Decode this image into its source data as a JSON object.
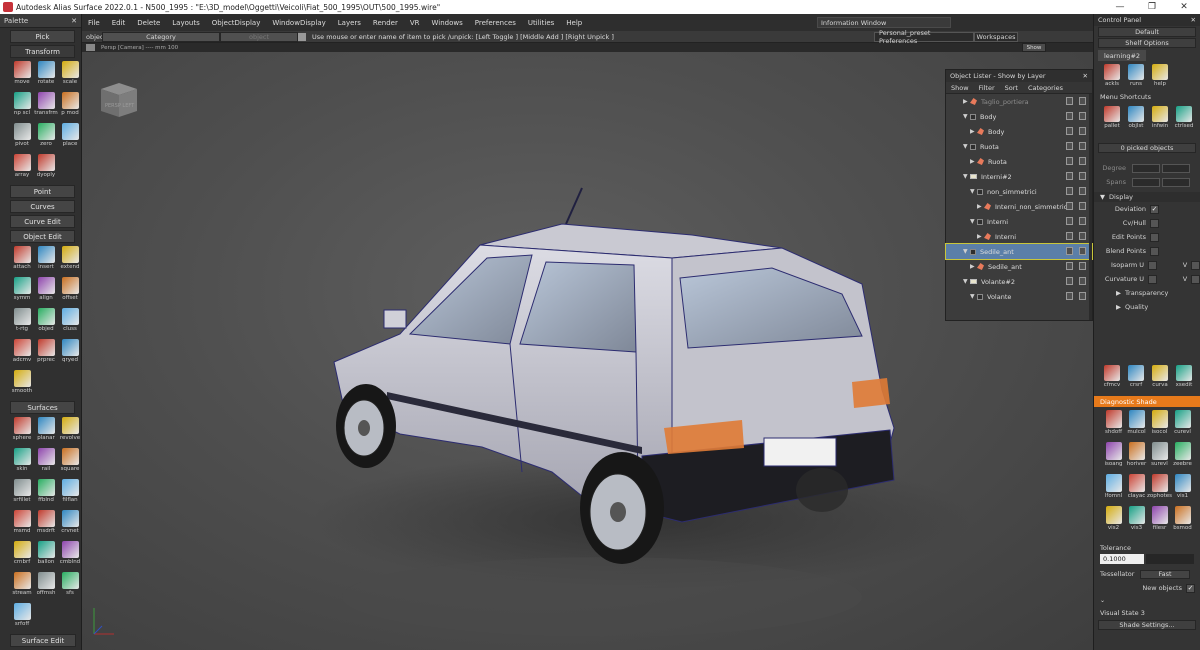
{
  "window": {
    "title": "Autodesk Alias Surface 2022.0.1   - N500_1995 : \"E:\\3D_model\\Oggetti\\Veicoli\\Fiat_500_1995\\OUT\\500_1995.wire\"",
    "min": "—",
    "max": "❐",
    "close": "✕"
  },
  "palette": {
    "title": "Palette",
    "close": "✕",
    "pick": "Pick",
    "transform": "Transform",
    "transform_tools": [
      "move",
      "rotate",
      "scale",
      "np scl",
      "transfrm",
      "p mod",
      "pivot",
      "zero",
      "place",
      "array",
      "dyoply"
    ],
    "point": "Point",
    "curves": "Curves",
    "curve_edit": "Curve Edit",
    "object_edit": "Object Edit",
    "object_edit_tools": [
      "attach",
      "insert",
      "extend",
      "symm",
      "align",
      "offset",
      "t-rtg",
      "objed",
      "cluss",
      "adcmv",
      "prprec",
      "qryed",
      "smooth"
    ],
    "surfaces": "Surfaces",
    "surface_tools": [
      "sphere",
      "planar",
      "revolve",
      "skin",
      "rail",
      "square",
      "srfillet",
      "ffblnd",
      "filflan",
      "msmd",
      "msdrft",
      "crvnet",
      "crnbrf",
      "ballon",
      "cmblnd",
      "stream",
      "offmsh",
      "sfs",
      "srfoff"
    ],
    "surface_edit": "Surface Edit"
  },
  "menubar": {
    "items": [
      "File",
      "Edit",
      "Delete",
      "Layouts",
      "ObjectDisplay",
      "WindowDisplay",
      "Layers",
      "Render",
      "VR",
      "Windows",
      "Preferences",
      "Utilities",
      "Help"
    ],
    "info_window": "Information Window"
  },
  "toolbar": {
    "object": "object",
    "category": "Category",
    "object_field": "object",
    "message": "Use mouse or enter name of item to pick /unpick: [Left Toggle ] [Middle Add ] [Right Unpick ]",
    "preset": "Personal_preset Preferences",
    "workspaces": "Workspaces",
    "show": "Show",
    "persp": "Persp [Camera] ---- mm 100"
  },
  "viewport": {
    "viewcube_label": "PERSP LEFT"
  },
  "lister": {
    "title": "Object Lister - Show by Layer",
    "close": "✕",
    "menu": [
      "Show",
      "Filter",
      "Sort",
      "Categories"
    ],
    "rows": [
      {
        "label": "Taglio_portiera",
        "indent": 1,
        "kind": "mesh",
        "tri": "▶",
        "dim": true
      },
      {
        "label": "Body",
        "indent": 1,
        "kind": "box",
        "tri": "▼"
      },
      {
        "label": "Body",
        "indent": 2,
        "kind": "mesh",
        "tri": "▶"
      },
      {
        "label": "Ruota",
        "indent": 1,
        "kind": "box",
        "tri": "▼"
      },
      {
        "label": "Ruota",
        "indent": 2,
        "kind": "mesh",
        "tri": "▶"
      },
      {
        "label": "Interni#2",
        "indent": 1,
        "kind": "fold",
        "tri": "▼"
      },
      {
        "label": "non_simmetrici",
        "indent": 2,
        "kind": "box",
        "tri": "▼"
      },
      {
        "label": "Interni_non_simmetrici",
        "indent": 3,
        "kind": "mesh",
        "tri": "▶"
      },
      {
        "label": "Interni",
        "indent": 2,
        "kind": "box",
        "tri": "▼"
      },
      {
        "label": "Interni",
        "indent": 3,
        "kind": "mesh",
        "tri": "▶"
      },
      {
        "label": "Sedile_ant",
        "indent": 1,
        "kind": "box",
        "tri": "▼",
        "selected": true
      },
      {
        "label": "Sedile_ant",
        "indent": 2,
        "kind": "mesh",
        "tri": "▶"
      },
      {
        "label": "Volante#2",
        "indent": 1,
        "kind": "fold",
        "tri": "▼"
      },
      {
        "label": "Volante",
        "indent": 2,
        "kind": "box",
        "tri": "▼"
      }
    ]
  },
  "control_panel": {
    "title": "Control Panel",
    "close": "✕",
    "default": "Default",
    "shelf_options": "Shelf Options",
    "learning_tab": "learning#2",
    "learning_tools": [
      "ackls",
      "runs",
      "help"
    ],
    "menu_shortcuts": "Menu Shortcuts",
    "shortcut_tools": [
      "pallet",
      "objlst",
      "infwin",
      "ctrlsed"
    ],
    "picked_objects": "0 picked objects",
    "degree": "Degree",
    "spans": "Spans",
    "display": "Display",
    "display_rows": [
      {
        "label": "Deviation",
        "checked": true
      },
      {
        "label": "Cv/Hull",
        "checked": false
      },
      {
        "label": "Edit Points",
        "checked": false
      },
      {
        "label": "Blend Points",
        "checked": false
      },
      {
        "label": "Isoparm U",
        "checked": false,
        "extra": "V"
      },
      {
        "label": "Curvature U",
        "checked": false,
        "extra": "V"
      }
    ],
    "transparency": "Transparency",
    "quality": "Quality",
    "eval_tools": [
      "cfmcv",
      "crsrf",
      "curva",
      "xsedit"
    ],
    "diagnostic_shade": "Diagnostic Shade",
    "diag_tools": [
      "shdoff",
      "mulcol",
      "isocol",
      "curevl",
      "isoang",
      "horiver",
      "surevl",
      "zeebre",
      "lfomnl",
      "clayac",
      "zophotes",
      "vis1",
      "vis2",
      "vis3",
      "filesr",
      "bsmod"
    ],
    "tolerance": "Tolerance",
    "tolerance_value": "0.1000",
    "tessellator": "Tessellator",
    "tessellator_value": "Fast",
    "new_objects": "New objects",
    "visual_state": "Visual State 3",
    "shade_settings": "Shade Settings..."
  }
}
